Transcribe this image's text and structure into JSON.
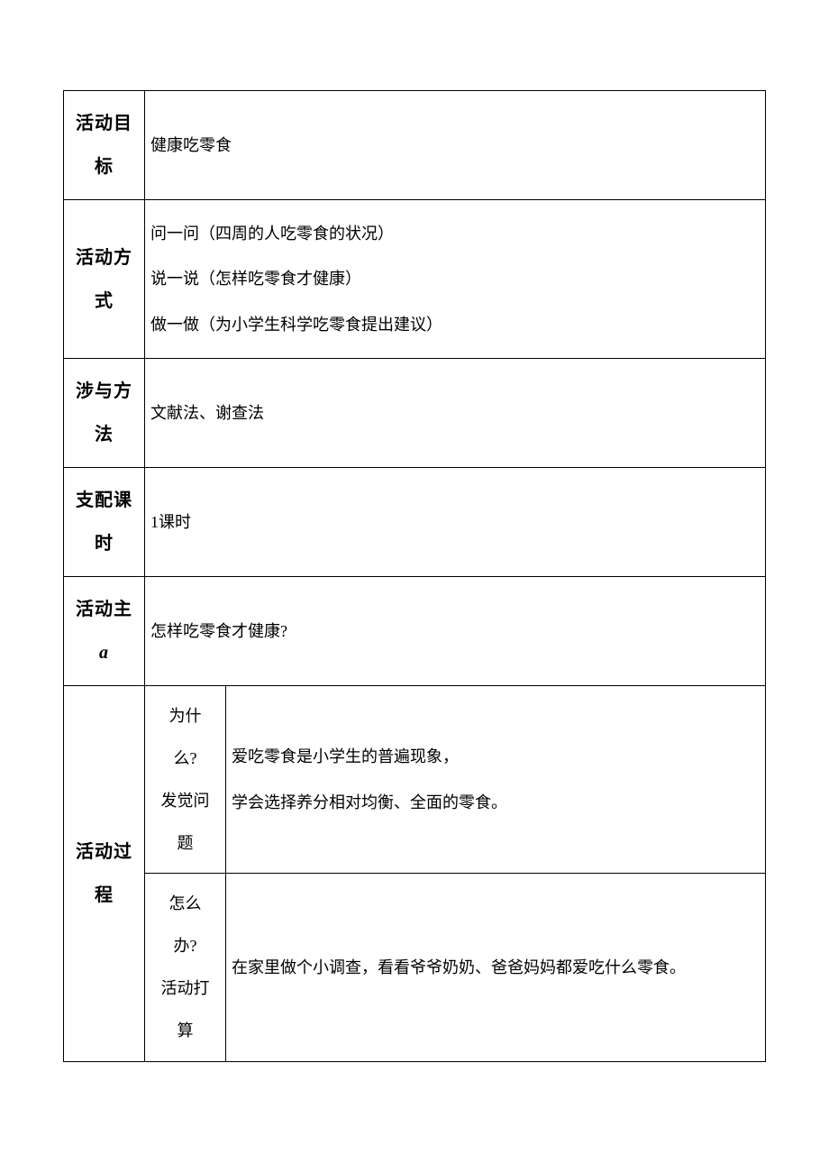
{
  "rows": {
    "goal": {
      "label": "活动目标",
      "content": "健康吃零食"
    },
    "method": {
      "label": "活动方式",
      "line1": "问一问（四周的人吃零食的状况）",
      "line2": "说一说（怎样吃零食才健康）",
      "line3": "做一做（为小学生科学吃零食提出建议）"
    },
    "approach": {
      "label": "涉与方法",
      "content": "文献法、谢查法"
    },
    "time": {
      "label": "支配课时",
      "content": "1课时"
    },
    "topic": {
      "label_part1": "活动主",
      "label_part2": "a",
      "content": "怎样吃零食才健康?"
    },
    "process": {
      "label": "活动过程",
      "sub1": {
        "label_line1": "为什",
        "label_line2": "么?",
        "label_line3": "发觉问",
        "label_line4": "题",
        "content_line1": "爱吃零食是小学生的普遍现象，",
        "content_line2": "学会选择养分相对均衡、全面的零食。"
      },
      "sub2": {
        "label_line1": "怎么",
        "label_line2": "办?",
        "label_line3": "活动打",
        "label_line4": "算",
        "content": "在家里做个小调查，看看爷爷奶奶、爸爸妈妈都爱吃什么零食。"
      }
    }
  }
}
